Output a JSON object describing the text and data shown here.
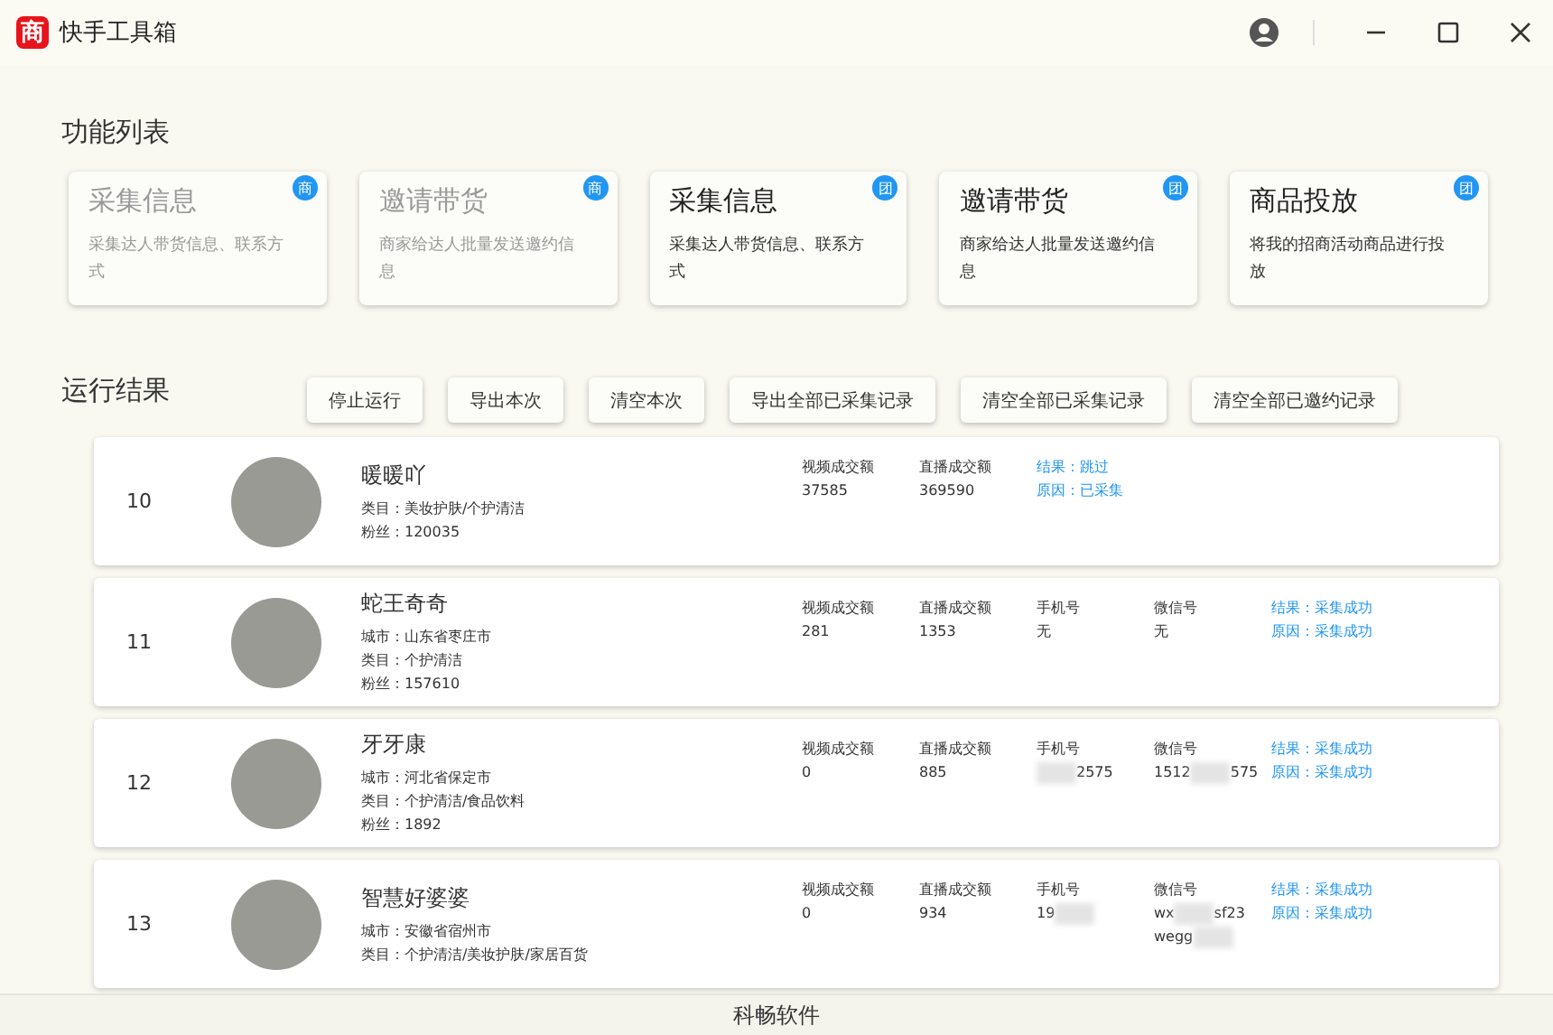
{
  "window": {
    "title": "快手工具箱",
    "logo": "商"
  },
  "features": {
    "title": "功能列表",
    "cards": [
      {
        "title": "采集信息",
        "desc": "采集达人带货信息、联系方式",
        "badge": "商",
        "disabled": true
      },
      {
        "title": "邀请带货",
        "desc": "商家给达人批量发送邀约信息",
        "badge": "商",
        "disabled": true
      },
      {
        "title": "采集信息",
        "desc": "采集达人带货信息、联系方式",
        "badge": "团",
        "disabled": false
      },
      {
        "title": "邀请带货",
        "desc": "商家给达人批量发送邀约信息",
        "badge": "团",
        "disabled": false
      },
      {
        "title": "商品投放",
        "desc": "将我的招商活动商品进行投放",
        "badge": "团",
        "disabled": false
      }
    ]
  },
  "results": {
    "title": "运行结果",
    "buttons": [
      "停止运行",
      "导出本次",
      "清空本次",
      "导出全部已采集记录",
      "清空全部已采集记录",
      "清空全部已邀约记录"
    ],
    "rows": [
      {
        "index": "10",
        "name": "暖暖吖",
        "info": [
          "类目：美妆护肤/个护清洁",
          "粉丝：120035"
        ],
        "stats": [
          {
            "label": "视频成交额",
            "lines": [
              [
                {
                  "kind": "text",
                  "text": "37585"
                }
              ]
            ]
          },
          {
            "label": "直播成交额",
            "lines": [
              [
                {
                  "kind": "text",
                  "text": "369590"
                }
              ]
            ]
          }
        ],
        "result": "结果：跳过",
        "reason": "原因：已采集"
      },
      {
        "index": "11",
        "name": "蛇王奇奇",
        "info": [
          "城市：山东省枣庄市",
          "类目：个护清洁",
          "粉丝：157610"
        ],
        "stats": [
          {
            "label": "视频成交额",
            "lines": [
              [
                {
                  "kind": "text",
                  "text": "281"
                }
              ]
            ]
          },
          {
            "label": "直播成交额",
            "lines": [
              [
                {
                  "kind": "text",
                  "text": "1353"
                }
              ]
            ]
          },
          {
            "label": "手机号",
            "lines": [
              [
                {
                  "kind": "text",
                  "text": "无"
                }
              ]
            ]
          },
          {
            "label": "微信号",
            "lines": [
              [
                {
                  "kind": "text",
                  "text": "无"
                }
              ]
            ]
          }
        ],
        "result": "结果：采集成功",
        "reason": "原因：采集成功"
      },
      {
        "index": "12",
        "name": "牙牙康",
        "info": [
          "城市：河北省保定市",
          "类目：个护清洁/食品饮料",
          "粉丝：1892"
        ],
        "stats": [
          {
            "label": "视频成交额",
            "lines": [
              [
                {
                  "kind": "text",
                  "text": "0"
                }
              ]
            ]
          },
          {
            "label": "直播成交额",
            "lines": [
              [
                {
                  "kind": "text",
                  "text": "885"
                }
              ]
            ]
          },
          {
            "label": "手机号",
            "lines": [
              [
                {
                  "kind": "mask"
                },
                {
                  "kind": "text",
                  "text": "2575"
                }
              ]
            ]
          },
          {
            "label": "微信号",
            "lines": [
              [
                {
                  "kind": "text",
                  "text": "1512"
                },
                {
                  "kind": "mask"
                },
                {
                  "kind": "text",
                  "text": "575"
                }
              ]
            ]
          }
        ],
        "result": "结果：采集成功",
        "reason": "原因：采集成功"
      },
      {
        "index": "13",
        "name": "智慧好婆婆",
        "info": [
          "城市：安徽省宿州市",
          "类目：个护清洁/美妆护肤/家居百货"
        ],
        "stats": [
          {
            "label": "视频成交额",
            "lines": [
              [
                {
                  "kind": "text",
                  "text": "0"
                }
              ]
            ]
          },
          {
            "label": "直播成交额",
            "lines": [
              [
                {
                  "kind": "text",
                  "text": "934"
                }
              ]
            ]
          },
          {
            "label": "手机号",
            "lines": [
              [
                {
                  "kind": "text",
                  "text": "19"
                },
                {
                  "kind": "mask"
                }
              ]
            ]
          },
          {
            "label": "微信号",
            "lines": [
              [
                {
                  "kind": "text",
                  "text": "wx"
                },
                {
                  "kind": "mask"
                },
                {
                  "kind": "text",
                  "text": "sf23"
                }
              ],
              [
                {
                  "kind": "text",
                  "text": "wegg"
                },
                {
                  "kind": "mask"
                }
              ]
            ]
          }
        ],
        "result": "结果：采集成功",
        "reason": "原因：采集成功"
      }
    ]
  },
  "footer": "科畅软件"
}
